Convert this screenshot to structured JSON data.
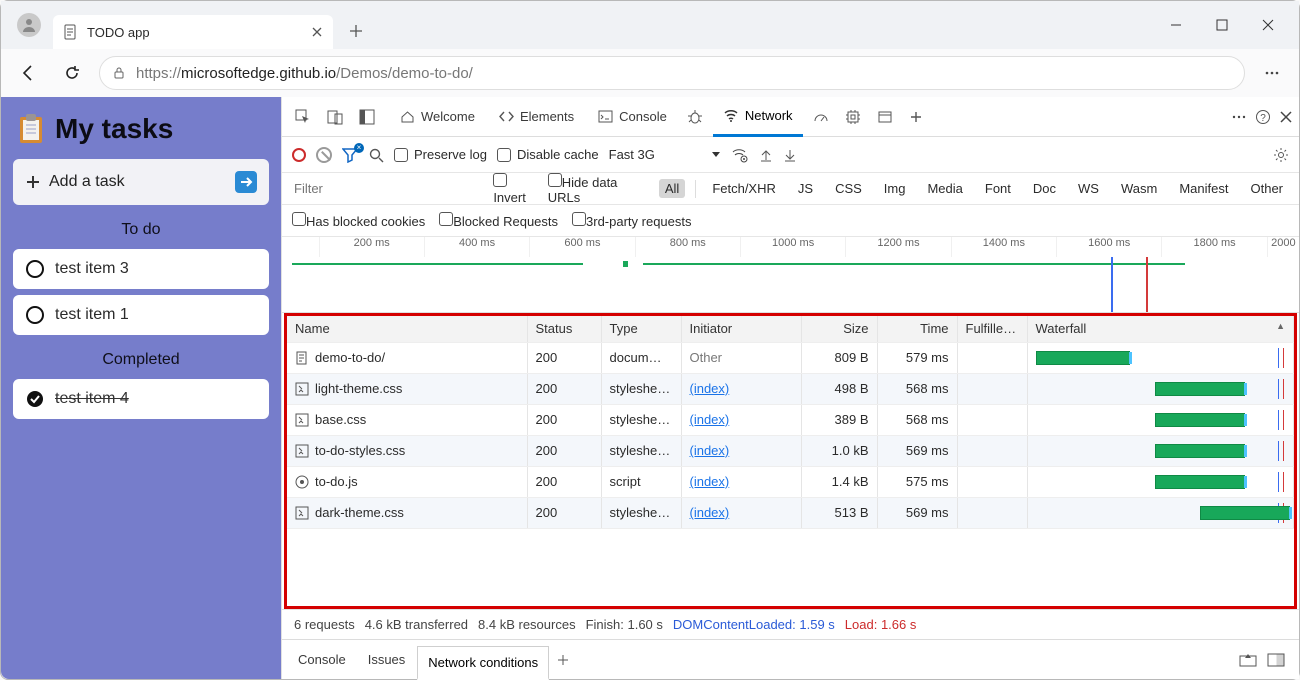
{
  "browser": {
    "tab_title": "TODO app",
    "url_host_prefix": "https://",
    "url_host": "microsoftedge.github.io",
    "url_path": "/Demos/demo-to-do/"
  },
  "app": {
    "title": "My tasks",
    "add_task_label": "Add a task",
    "section_todo": "To do",
    "section_completed": "Completed",
    "todo_items": [
      "test item 3",
      "test item 1"
    ],
    "completed_items": [
      "test item 4"
    ]
  },
  "devtools": {
    "tabs": {
      "welcome": "Welcome",
      "elements": "Elements",
      "console": "Console",
      "network": "Network"
    },
    "toolbar": {
      "preserve_log": "Preserve log",
      "disable_cache": "Disable cache",
      "throttle": "Fast 3G"
    },
    "filters": {
      "placeholder": "Filter",
      "invert": "Invert",
      "hide_data_urls": "Hide data URLs",
      "types": [
        "All",
        "Fetch/XHR",
        "JS",
        "CSS",
        "Img",
        "Media",
        "Font",
        "Doc",
        "WS",
        "Wasm",
        "Manifest",
        "Other"
      ],
      "has_blocked_cookies": "Has blocked cookies",
      "blocked_requests": "Blocked Requests",
      "third_party": "3rd-party requests"
    },
    "overview_ticks": [
      "200 ms",
      "400 ms",
      "600 ms",
      "800 ms",
      "1000 ms",
      "1200 ms",
      "1400 ms",
      "1600 ms",
      "1800 ms",
      "2000"
    ],
    "columns": {
      "name": "Name",
      "status": "Status",
      "type": "Type",
      "initiator": "Initiator",
      "size": "Size",
      "time": "Time",
      "fulfilled": "Fulfilled…",
      "waterfall": "Waterfall"
    },
    "requests": [
      {
        "icon": "doc",
        "name": "demo-to-do/",
        "status": "200",
        "type": "docum…",
        "initiator": "Other",
        "initiator_link": false,
        "size": "809 B",
        "time": "579 ms",
        "wf_start": 0,
        "wf_width": 38
      },
      {
        "icon": "css",
        "name": "light-theme.css",
        "status": "200",
        "type": "styleshe…",
        "initiator": "(index)",
        "initiator_link": true,
        "size": "498 B",
        "time": "568 ms",
        "wf_start": 48,
        "wf_width": 36
      },
      {
        "icon": "css",
        "name": "base.css",
        "status": "200",
        "type": "styleshe…",
        "initiator": "(index)",
        "initiator_link": true,
        "size": "389 B",
        "time": "568 ms",
        "wf_start": 48,
        "wf_width": 36
      },
      {
        "icon": "css",
        "name": "to-do-styles.css",
        "status": "200",
        "type": "styleshe…",
        "initiator": "(index)",
        "initiator_link": true,
        "size": "1.0 kB",
        "time": "569 ms",
        "wf_start": 48,
        "wf_width": 36
      },
      {
        "icon": "js",
        "name": "to-do.js",
        "status": "200",
        "type": "script",
        "initiator": "(index)",
        "initiator_link": true,
        "size": "1.4 kB",
        "time": "575 ms",
        "wf_start": 48,
        "wf_width": 36
      },
      {
        "icon": "css",
        "name": "dark-theme.css",
        "status": "200",
        "type": "styleshe…",
        "initiator": "(index)",
        "initiator_link": true,
        "size": "513 B",
        "time": "569 ms",
        "wf_start": 66,
        "wf_width": 36
      }
    ],
    "wf_guides": {
      "blue": 97,
      "red": 99
    },
    "summary": {
      "requests": "6 requests",
      "transferred": "4.6 kB transferred",
      "resources": "8.4 kB resources",
      "finish": "Finish: 1.60 s",
      "dcl": "DOMContentLoaded: 1.59 s",
      "load": "Load: 1.66 s"
    },
    "drawer": {
      "console": "Console",
      "issues": "Issues",
      "network_conditions": "Network conditions"
    }
  }
}
